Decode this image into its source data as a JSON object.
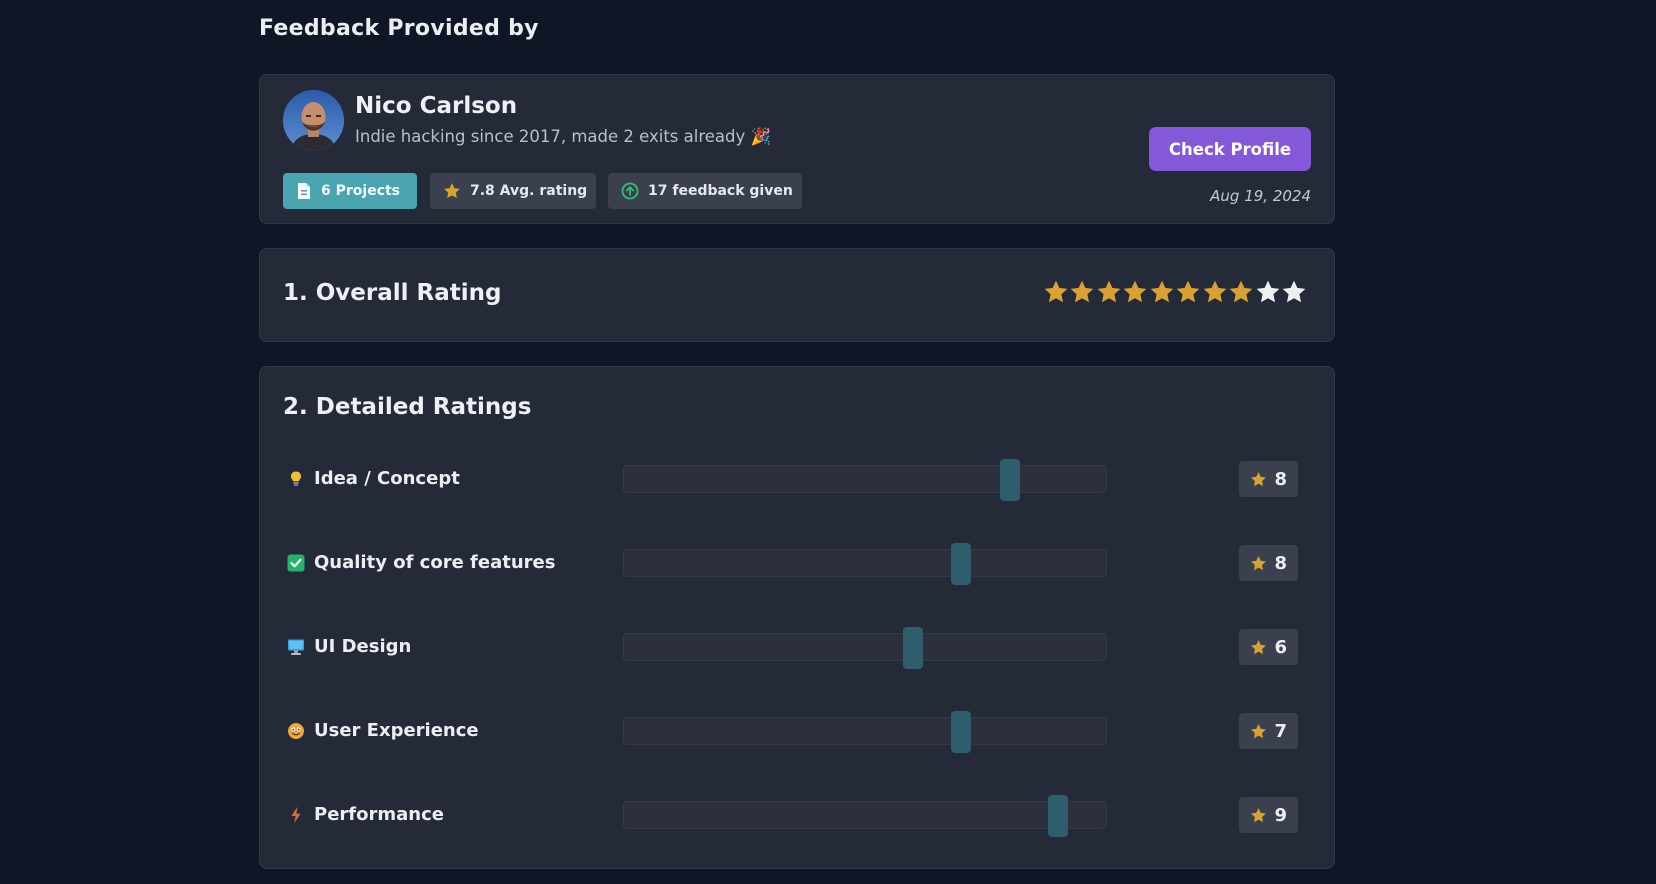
{
  "page": {
    "title": "Feedback Provided by"
  },
  "reviewer": {
    "name": "Nico Carlson",
    "bio": "Indie hacking since 2017, made 2 exits already 🎉",
    "stats": {
      "projects": "6 Projects",
      "avg_rating": "7.8 Avg. rating",
      "feedback_given": "17 feedback given"
    },
    "check_profile_label": "Check Profile",
    "date": "Aug 19, 2024"
  },
  "overall": {
    "title": "1. Overall Rating",
    "rating": 8,
    "max": 10
  },
  "detailed": {
    "title": "2. Detailed Ratings",
    "items": [
      {
        "icon": "lightbulb-icon",
        "label": "Idea / Concept",
        "score": "8",
        "slider_fraction": 0.8
      },
      {
        "icon": "checkbox-icon",
        "label": "Quality of core features",
        "score": "8",
        "slider_fraction": 0.7
      },
      {
        "icon": "monitor-icon",
        "label": "UI Design",
        "score": "6",
        "slider_fraction": 0.6
      },
      {
        "icon": "smiley-icon",
        "label": "User Experience",
        "score": "7",
        "slider_fraction": 0.7
      },
      {
        "icon": "lightning-icon",
        "label": "Performance",
        "score": "9",
        "slider_fraction": 0.9
      }
    ]
  },
  "colors": {
    "accent_purple": "#8459d9",
    "teal_chip": "#4ba5b0",
    "star_gold": "#d9a12f",
    "star_empty": "#eef0f4",
    "slider_thumb": "#2e5d6b"
  }
}
